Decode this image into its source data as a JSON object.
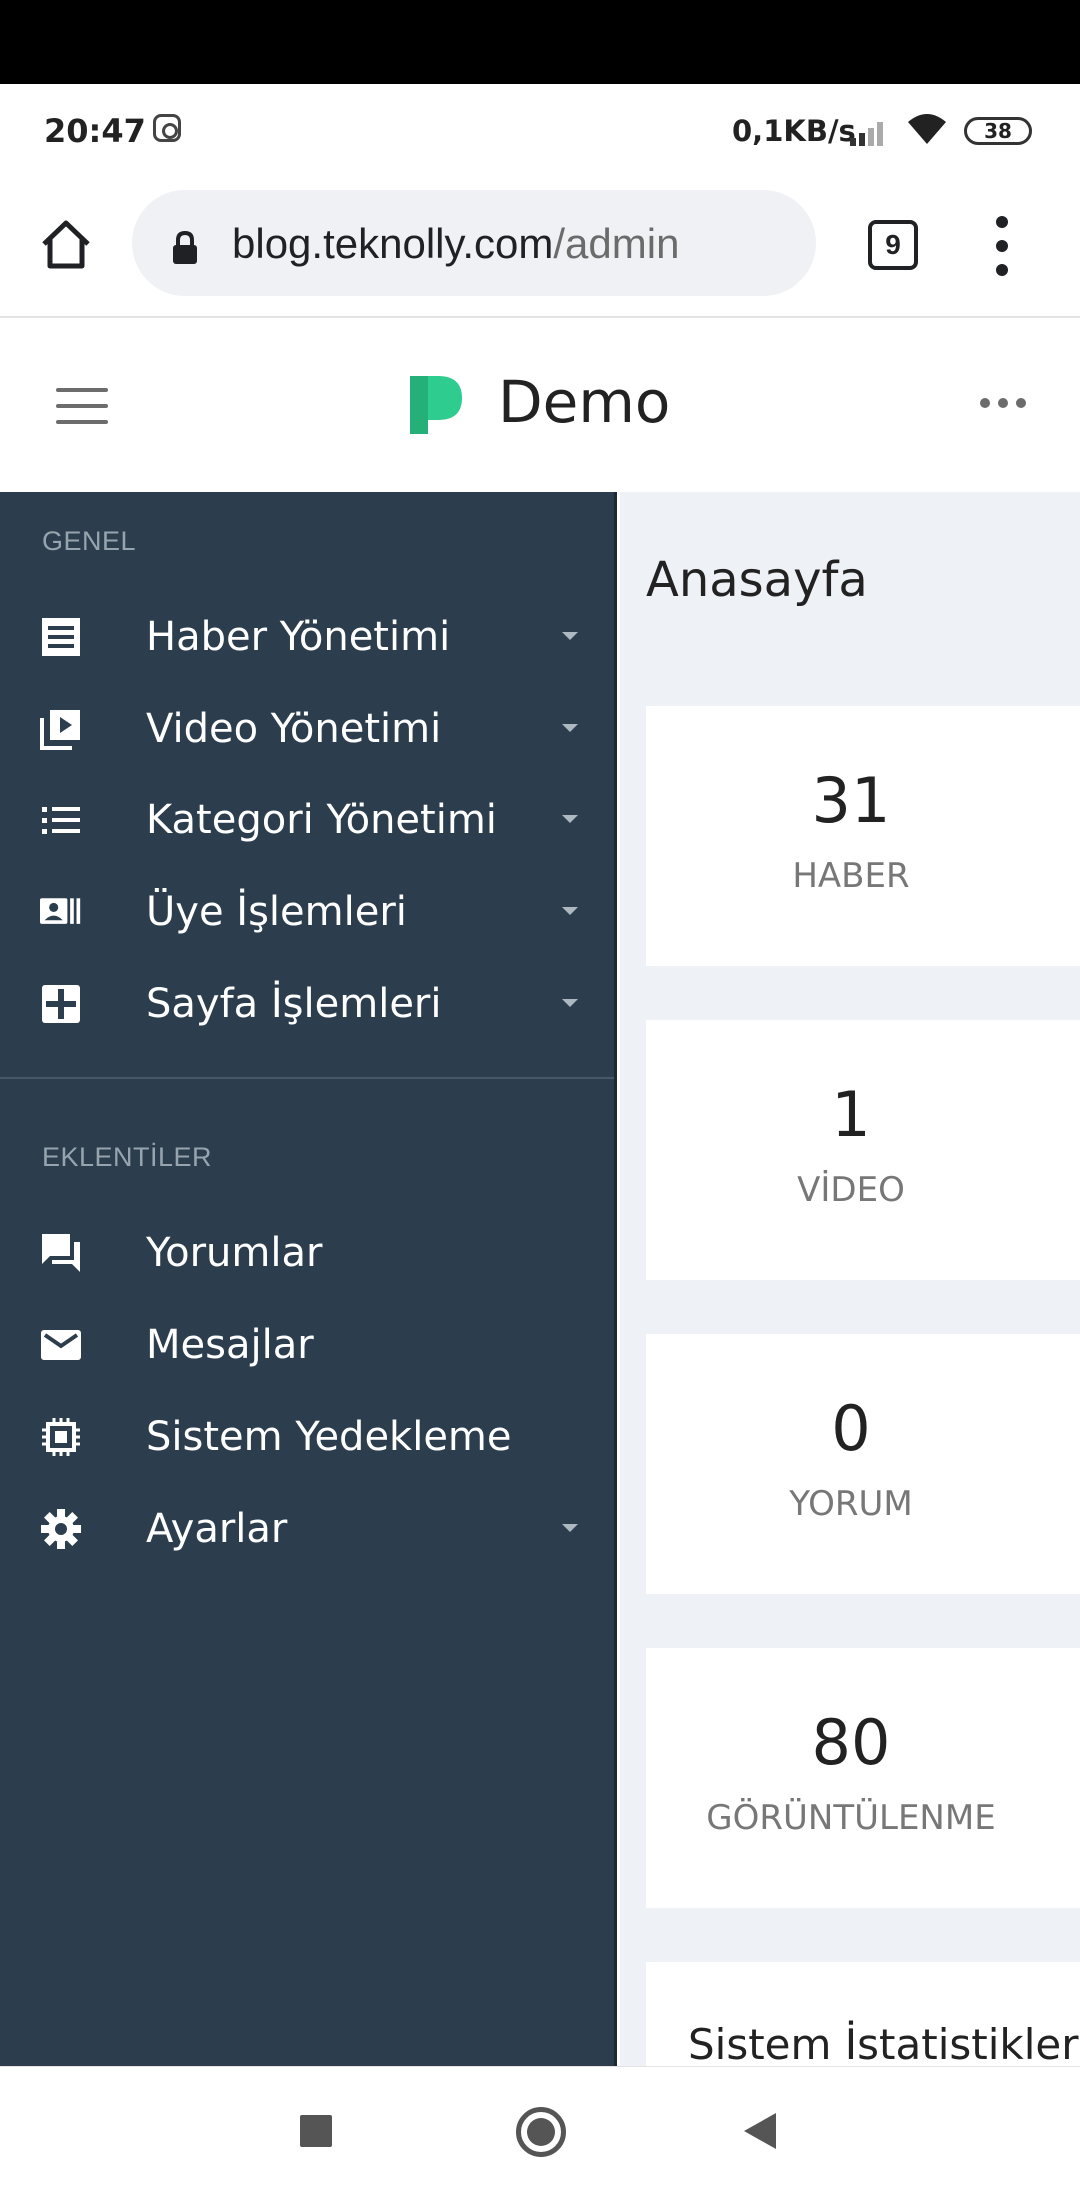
{
  "status_bar": {
    "time": "20:47",
    "network_speed": "0,1KB/s",
    "battery": "38"
  },
  "browser": {
    "url_host": "blog.teknolly.com",
    "url_path": "/admin",
    "tab_count": "9"
  },
  "app_header": {
    "brand": "Demo",
    "logo_color": "#2ecc8f"
  },
  "sidebar": {
    "background": "#2c3e4d",
    "section_general": "GENEL",
    "items_general": [
      {
        "label": "Haber Yönetimi",
        "icon": "newspaper-icon"
      },
      {
        "label": "Video Yönetimi",
        "icon": "video-library-icon"
      },
      {
        "label": "Kategori Yönetimi",
        "icon": "list-icon"
      },
      {
        "label": "Üye İşlemleri",
        "icon": "contact-card-icon"
      },
      {
        "label": "Sayfa İşlemleri",
        "icon": "puzzle-icon"
      }
    ],
    "section_plugins": "EKLENTİLER",
    "items_plugins": [
      {
        "label": "Yorumlar",
        "icon": "comments-icon"
      },
      {
        "label": "Mesajlar",
        "icon": "mail-icon"
      },
      {
        "label": "Sistem Yedekleme",
        "icon": "chip-icon"
      },
      {
        "label": "Ayarlar",
        "icon": "gear-icon"
      }
    ]
  },
  "main": {
    "title": "Anasayfa",
    "cards": [
      {
        "value": "31",
        "label": "HABER"
      },
      {
        "value": "1",
        "label": "VİDEO"
      },
      {
        "value": "0",
        "label": "YORUM"
      },
      {
        "value": "80",
        "label": "GÖRÜNTÜLENME"
      }
    ],
    "stats_title": "Sistem İstatistikler"
  }
}
